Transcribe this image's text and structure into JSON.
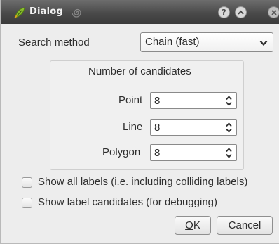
{
  "window": {
    "title": "Dialog",
    "title_icon": "qgis-leaf-icon",
    "controls": {
      "help": "?",
      "shade": "⌃",
      "close": "×"
    }
  },
  "search_method": {
    "label": "Search method",
    "selected": "Chain (fast)"
  },
  "candidates": {
    "title": "Number of candidates",
    "point": {
      "label": "Point",
      "value": "8"
    },
    "line": {
      "label": "Line",
      "value": "8"
    },
    "polygon": {
      "label": "Polygon",
      "value": "8"
    }
  },
  "options": {
    "show_all_labels": {
      "label": "Show all labels (i.e. including colliding labels)",
      "checked": false
    },
    "show_candidates": {
      "label": "Show label candidates (for debugging)",
      "checked": false
    }
  },
  "buttons": {
    "ok_mnemonic": "O",
    "ok_rest": "K",
    "cancel": "Cancel"
  },
  "colors": {
    "titlebar": "#4a4a4a",
    "window_bg": "#ededed"
  }
}
